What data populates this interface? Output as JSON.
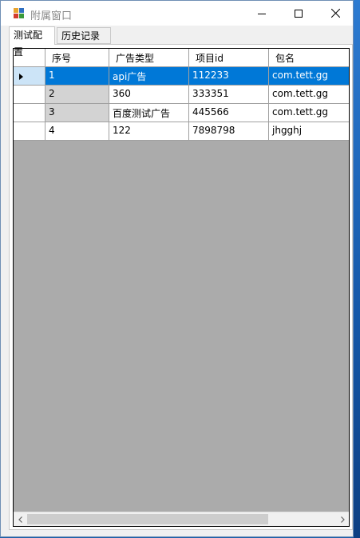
{
  "window": {
    "title": "附属窗口"
  },
  "tabs": [
    {
      "label": "测试配置",
      "active": true
    },
    {
      "label": "历史记录",
      "active": false
    }
  ],
  "grid": {
    "columns": [
      "",
      "序号",
      "广告类型",
      "项目id",
      "包名"
    ],
    "rows": [
      {
        "cells": [
          "",
          "1",
          "api广告",
          "112233",
          "com.tett.gg"
        ],
        "selected": true
      },
      {
        "cells": [
          "",
          "2",
          "360",
          "333351",
          "com.tett.gg"
        ],
        "selected": false
      },
      {
        "cells": [
          "",
          "3",
          "百度测试广告",
          "445566",
          "com.tett.gg"
        ],
        "selected": false
      },
      {
        "cells": [
          "",
          "4",
          "122",
          "7898798",
          "jhgghj"
        ],
        "selected": false
      }
    ]
  },
  "icons": {
    "app": "app-icon",
    "minimize": "minimize-icon",
    "maximize": "maximize-icon",
    "close": "close-icon",
    "row_indicator": "row-indicator-icon",
    "scroll_left": "chevron-left-icon",
    "scroll_right": "chevron-right-icon"
  },
  "colors": {
    "selection": "#0078d7",
    "grid_background": "#ababab",
    "title_text": "#8a8a8a"
  }
}
